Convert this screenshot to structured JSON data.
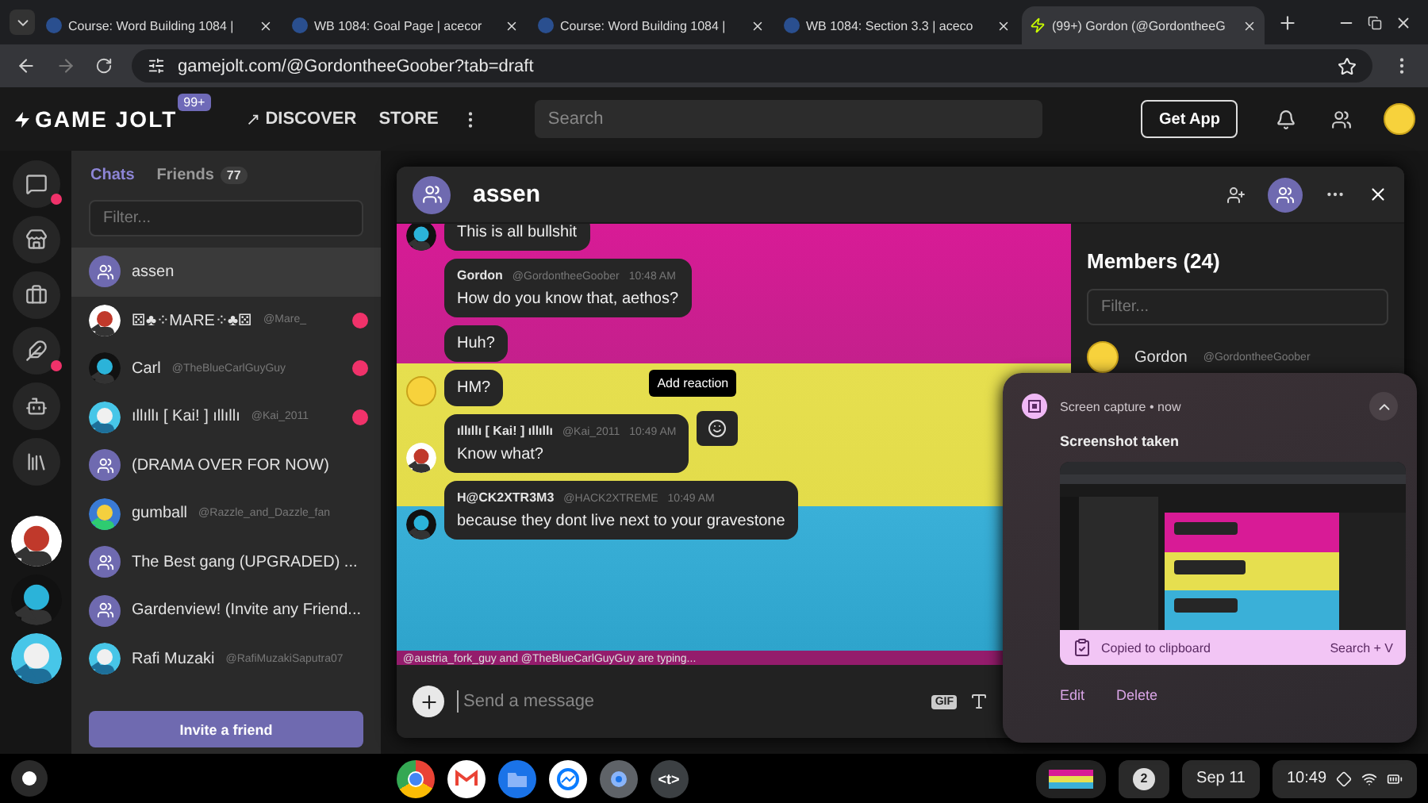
{
  "browser": {
    "tabs": [
      {
        "title": "Course: Word Building 1084 |",
        "selected": false
      },
      {
        "title": "WB 1084: Goal Page | acecor",
        "selected": false
      },
      {
        "title": "Course: Word Building 1084 |",
        "selected": false
      },
      {
        "title": "WB 1084: Section 3.3 | aceco",
        "selected": false
      },
      {
        "title": "(99+) Gordon (@GordontheeG",
        "selected": true
      }
    ],
    "url": "gamejolt.com/@GordontheeGoober?tab=draft"
  },
  "header": {
    "logo": "GAME JOLT",
    "badge": "99+",
    "nav": [
      "DISCOVER",
      "STORE"
    ],
    "search": {
      "placeholder": "Search"
    },
    "get_app": "Get App"
  },
  "rail": [
    {
      "kind": "chat",
      "alert": true
    },
    {
      "kind": "store",
      "alert": false
    },
    {
      "kind": "bag",
      "alert": false
    },
    {
      "kind": "quill",
      "alert": true
    },
    {
      "kind": "robot",
      "alert": false
    },
    {
      "kind": "library",
      "alert": false
    },
    {
      "kind": "picture"
    },
    {
      "kind": "picture"
    },
    {
      "kind": "picture"
    }
  ],
  "chat_list": {
    "tabs": [
      {
        "label": "Chats",
        "selected": true
      },
      {
        "label": "Friends",
        "count": "77",
        "selected": false
      }
    ],
    "filter": {
      "placeholder": "Filter..."
    },
    "items": [
      {
        "name": "assen",
        "kind": "group",
        "selected": true,
        "unread": false
      },
      {
        "name": "⚄♣⁘MARE⁘♣⚄",
        "handle": "@Mare_",
        "kind": "user",
        "selected": false,
        "unread": true
      },
      {
        "name": "Carl",
        "handle": "@TheBlueCarlGuyGuy",
        "kind": "user",
        "selected": false,
        "unread": true
      },
      {
        "name": "ıllıllı [ Kai! ] ıllıllı",
        "handle": "@Kai_2011",
        "kind": "user",
        "selected": false,
        "unread": true
      },
      {
        "name": "(DRAMA OVER FOR NOW)",
        "kind": "group",
        "selected": false,
        "unread": false
      },
      {
        "name": "gumball",
        "handle": "@Razzle_and_Dazzle_fan",
        "kind": "user",
        "selected": false,
        "unread": false
      },
      {
        "name": "The Best gang (UPGRADED) ...",
        "kind": "group",
        "selected": false,
        "unread": false
      },
      {
        "name": "Gardenview! (Invite any Friend...",
        "kind": "group",
        "selected": false,
        "unread": false
      },
      {
        "name": "Rafi Muzaki",
        "handle": "@RafiMuzakiSaputra07",
        "kind": "user",
        "selected": false,
        "unread": false
      }
    ],
    "invite": "Invite a friend"
  },
  "chat": {
    "title": "assen",
    "messages": [
      {
        "text": "This is all bullshit",
        "avatar": true
      },
      {
        "author": "Gordon",
        "handle": "@GordontheeGoober",
        "time": "10:48 AM",
        "text": "How do you know that, aethos?",
        "avatar": false
      },
      {
        "text": "Huh?",
        "avatar": false
      },
      {
        "text": "HM?",
        "avatar": true
      },
      {
        "author": "ıllıllı [ Kai! ] ıllıllı",
        "handle": "@Kai_2011",
        "time": "10:49 AM",
        "text": "Know what?",
        "avatar": true,
        "reaction": true
      },
      {
        "author": "H@CK2XTR3M3",
        "handle": "@HACK2XTREME",
        "time": "10:49 AM",
        "text": "because they dont live next to your gravestone",
        "avatar": true
      }
    ],
    "tooltip": "Add reaction",
    "typing": "@austria_fork_guy and @TheBlueCarlGuyGuy are typing...",
    "input": {
      "placeholder": "Send a message"
    },
    "gif": "GIF"
  },
  "members": {
    "title": "Members (24)",
    "filter": {
      "placeholder": "Filter..."
    },
    "items": [
      {
        "name": "Gordon",
        "handle": "@GordontheeGoober"
      }
    ]
  },
  "notification": {
    "source": "Screen capture",
    "separator": "•",
    "time": "now",
    "title": "Screenshot taken",
    "copied": "Copied to clipboard",
    "shortcut": "Search + V",
    "actions": [
      "Edit",
      "Delete"
    ]
  },
  "taskbar": {
    "apps": [
      {
        "kind": "chrome"
      },
      {
        "kind": "gmail"
      },
      {
        "kind": "files"
      },
      {
        "kind": "messenger"
      },
      {
        "kind": "settings"
      },
      {
        "kind": "terminal",
        "label": "<t>"
      }
    ],
    "notifications": "2",
    "date": "Sep 11",
    "time": "10:49"
  }
}
